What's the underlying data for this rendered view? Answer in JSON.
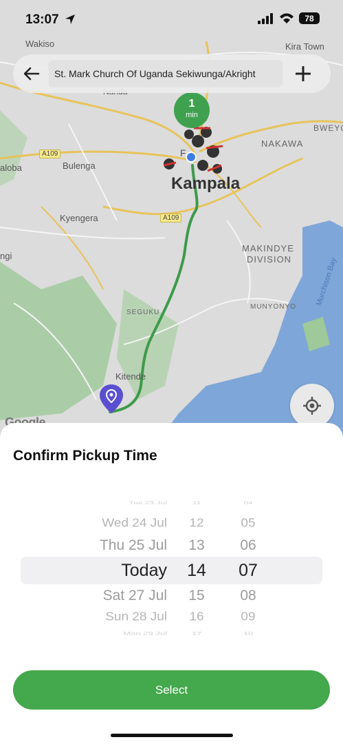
{
  "status_bar": {
    "time": "13:07",
    "battery": "78"
  },
  "search": {
    "value": "St. Mark Church Of Uganda Sekiwunga/Akright"
  },
  "map": {
    "labels": {
      "wakiso": "Wakiso",
      "kira_town": "Kira Town",
      "bweyo": "BWEYO",
      "nakawa": "NAKAWA",
      "kampala": "Kampala",
      "bulenga": "Bulenga",
      "aloba": "aloba",
      "kyengera": "Kyengera",
      "makindye": "MAKINDYE",
      "division": "DIVISION",
      "murchison_bay": "Murchison Bay",
      "munyonyo": "MUNYONYO",
      "seguku": "SEGUKU",
      "kitende": "Kitende",
      "ngi": "ngi",
      "nanda": "Nanda",
      "f_label": "F"
    },
    "road_a109_left": "A109",
    "road_a109_center": "A109",
    "attribution": "Google",
    "eta": {
      "value": "1",
      "unit": "min"
    }
  },
  "sheet": {
    "title": "Confirm Pickup Time",
    "select_label": "Select"
  },
  "picker": {
    "days": [
      "Tue 23 Jul",
      "Wed 24 Jul",
      "Thu 25 Jul",
      "Today",
      "Sat 27 Jul",
      "Sun 28 Jul",
      "Mon 29 Jul"
    ],
    "hours": [
      "11",
      "12",
      "13",
      "14",
      "15",
      "16",
      "17"
    ],
    "minutes": [
      "04",
      "05",
      "06",
      "07",
      "08",
      "09",
      "10"
    ],
    "selected_index": 3
  }
}
